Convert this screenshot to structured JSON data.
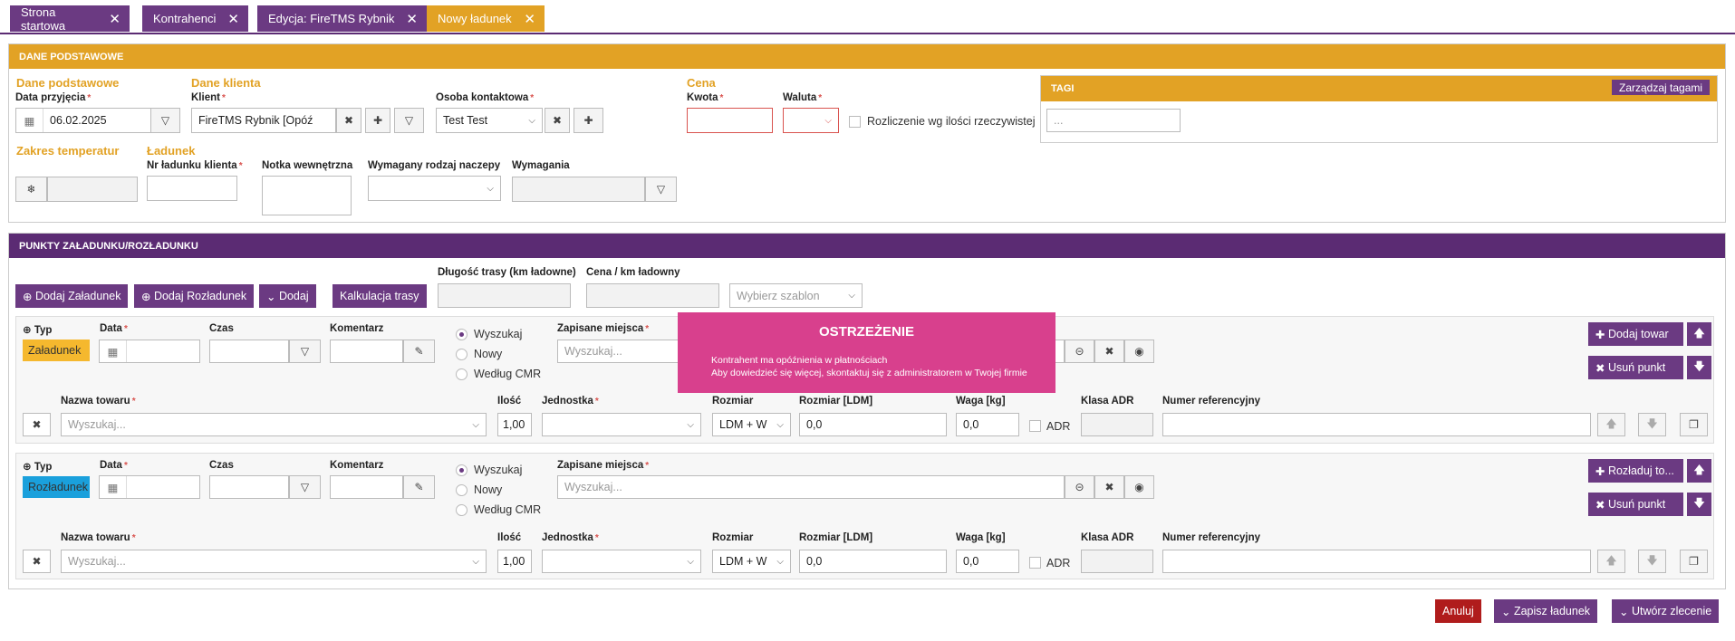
{
  "tabs": [
    {
      "label": "Strona startowa"
    },
    {
      "label": "Kontrahenci"
    },
    {
      "label": "Edycja: FireTMS Rybnik"
    },
    {
      "label": "Nowy ładunek"
    }
  ],
  "basic": {
    "header": "DANE PODSTAWOWE",
    "sec_basic": "Dane podstawowe",
    "sec_client": "Dane klienta",
    "sec_price": "Cena",
    "sec_temp": "Zakres temperatur",
    "sec_load": "Ładunek",
    "date_label": "Data przyjęcia",
    "date_value": "06.02.2025",
    "client_label": "Klient",
    "client_value": "FireTMS Rybnik [Opóź",
    "contact_label": "Osoba kontaktowa",
    "contact_value": "Test Test",
    "amount_label": "Kwota",
    "currency_label": "Waluta",
    "settle_label": "Rozliczenie wg ilości rzeczywistej",
    "tags_header": "TAGI",
    "tags_button": "Zarządzaj tagami",
    "tags_placeholder": "...",
    "order_no_label": "Nr ładunku klienta",
    "note_label": "Notka wewnętrzna",
    "trailer_label": "Wymagany rodzaj naczepy",
    "req_label": "Wymagania"
  },
  "points": {
    "header": "PUNKTY ZAŁADUNKU/ROZŁADUNKU",
    "add_load": "Dodaj Załadunek",
    "add_unload": "Dodaj Rozładunek",
    "add": "Dodaj",
    "calc": "Kalkulacja trasy",
    "route_len_label": "Długość trasy (km ładowne)",
    "price_km_label": "Cena / km ładowny",
    "template_placeholder": "Wybierz szablon",
    "rows": [
      {
        "type_label": "Typ",
        "type_value": "Załadunek",
        "type_color": "#f5b82e",
        "date_label": "Data",
        "time_label": "Czas",
        "comment_label": "Komentarz",
        "radios": [
          "Wyszukaj",
          "Nowy",
          "Według CMR"
        ],
        "places_label": "Zapisane miejsca",
        "places_placeholder": "Wyszukaj...",
        "btn_goods": "Dodaj towar",
        "btn_remove": "Usuń punkt",
        "goods_label": "Nazwa towaru",
        "goods_placeholder": "Wyszukaj...",
        "qty_label": "Ilość",
        "qty_value": "1,00",
        "unit_label": "Jednostka",
        "size_label": "Rozmiar",
        "size_value": "LDM + W",
        "ldm_label": "Rozmiar [LDM]",
        "ldm_value": "0,0",
        "weight_label": "Waga [kg]",
        "weight_value": "0,0",
        "adr_check": "ADR",
        "adr_label": "Klasa ADR",
        "ref_label": "Numer referencyjny"
      },
      {
        "type_label": "Typ",
        "type_value": "Rozładunek",
        "type_color": "#1aa0dc",
        "date_label": "Data",
        "time_label": "Czas",
        "comment_label": "Komentarz",
        "radios": [
          "Wyszukaj",
          "Nowy",
          "Według CMR"
        ],
        "places_label": "Zapisane miejsca",
        "places_placeholder": "Wyszukaj...",
        "btn_goods": "Rozładuj to...",
        "btn_remove": "Usuń punkt",
        "goods_label": "Nazwa towaru",
        "goods_placeholder": "Wyszukaj...",
        "qty_label": "Ilość",
        "qty_value": "1,00",
        "unit_label": "Jednostka",
        "size_label": "Rozmiar",
        "size_value": "LDM + W",
        "ldm_label": "Rozmiar [LDM]",
        "ldm_value": "0,0",
        "weight_label": "Waga [kg]",
        "weight_value": "0,0",
        "adr_check": "ADR",
        "adr_label": "Klasa ADR",
        "ref_label": "Numer referencyjny"
      }
    ]
  },
  "warning": {
    "title": "OSTRZEŻENIE",
    "line1": "Kontrahent ma opóźnienia w płatnościach",
    "line2": "Aby dowiedzieć się więcej, skontaktuj się z administratorem w Twojej firmie"
  },
  "footer": {
    "cancel": "Anuluj",
    "save": "Zapisz ładunek",
    "create": "Utwórz zlecenie"
  },
  "colors": {
    "purple": "#6b3a82",
    "gold": "#e2a225",
    "danger": "#b01c1c",
    "warning": "#d8408d"
  }
}
